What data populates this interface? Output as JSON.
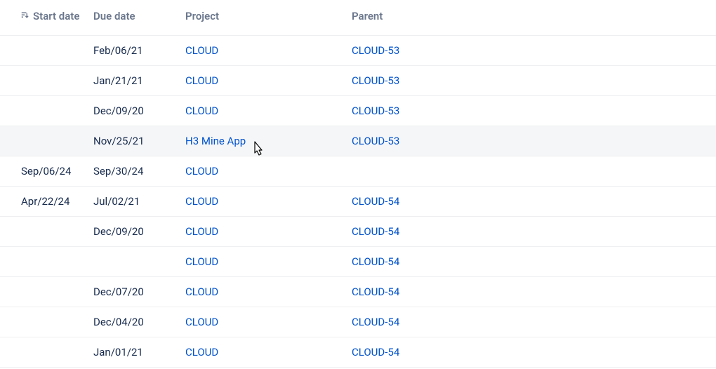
{
  "headers": {
    "start_date": "Start date",
    "due_date": "Due date",
    "project": "Project",
    "parent": "Parent"
  },
  "rows": [
    {
      "start": "",
      "due": "Feb/06/21",
      "project": "CLOUD",
      "parent": "CLOUD-53",
      "hovered": false
    },
    {
      "start": "",
      "due": "Jan/21/21",
      "project": "CLOUD",
      "parent": "CLOUD-53",
      "hovered": false
    },
    {
      "start": "",
      "due": "Dec/09/20",
      "project": "CLOUD",
      "parent": "CLOUD-53",
      "hovered": false
    },
    {
      "start": "",
      "due": "Nov/25/21",
      "project": "H3 Mine App",
      "parent": "CLOUD-53",
      "hovered": true
    },
    {
      "start": "Sep/06/24",
      "due": "Sep/30/24",
      "project": "CLOUD",
      "parent": "",
      "hovered": false
    },
    {
      "start": "Apr/22/24",
      "due": "Jul/02/21",
      "project": "CLOUD",
      "parent": "CLOUD-54",
      "hovered": false
    },
    {
      "start": "",
      "due": "Dec/09/20",
      "project": "CLOUD",
      "parent": "CLOUD-54",
      "hovered": false
    },
    {
      "start": "",
      "due": "",
      "project": "CLOUD",
      "parent": "CLOUD-54",
      "hovered": false
    },
    {
      "start": "",
      "due": "Dec/07/20",
      "project": "CLOUD",
      "parent": "CLOUD-54",
      "hovered": false
    },
    {
      "start": "",
      "due": "Dec/04/20",
      "project": "CLOUD",
      "parent": "CLOUD-54",
      "hovered": false
    },
    {
      "start": "",
      "due": "Jan/01/21",
      "project": "CLOUD",
      "parent": "CLOUD-54",
      "hovered": false
    }
  ]
}
